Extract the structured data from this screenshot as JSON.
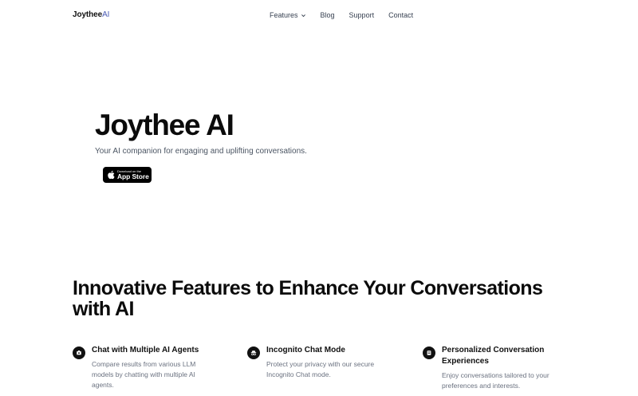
{
  "nav": {
    "logo_main": "Joythee",
    "logo_accent": "AI",
    "items": [
      {
        "label": "Features",
        "has_dropdown": true
      },
      {
        "label": "Blog"
      },
      {
        "label": "Support"
      },
      {
        "label": "Contact"
      }
    ]
  },
  "hero": {
    "title": "Joythee AI",
    "subtitle": "Your AI companion for engaging and uplifting conversations.",
    "app_store": {
      "small": "Download on the",
      "big": "App Store"
    }
  },
  "features": {
    "title": "Innovative Features to Enhance Your Conversations with AI",
    "items": [
      {
        "icon": "chat-agents-icon",
        "title": "Chat with Multiple AI Agents",
        "description": "Compare results from various LLM models by chatting with multiple AI agents."
      },
      {
        "icon": "incognito-icon",
        "title": "Incognito Chat Mode",
        "description": "Protect your privacy with our secure Incognito Chat mode."
      },
      {
        "icon": "personalize-icon",
        "title": "Personalized Conversation Experiences",
        "description": "Enjoy conversations tailored to your preferences and interests."
      }
    ]
  },
  "colors": {
    "accent": "#4a5bb5",
    "text": "#111111",
    "muted": "#6b7280"
  }
}
